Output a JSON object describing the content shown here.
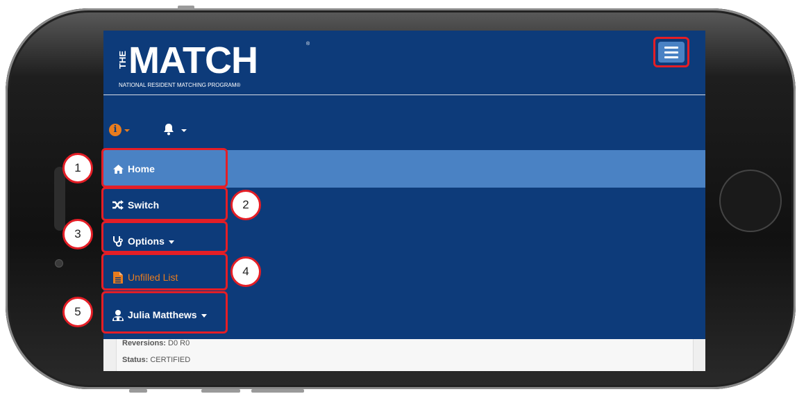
{
  "header": {
    "logo_the": "THE",
    "logo_title": "MATCH",
    "logo_subtitle": "NATIONAL RESIDENT MATCHING PROGRAM®",
    "logo_reg": "®"
  },
  "toolbar": {
    "info_icon": "info-circle-icon",
    "bell_icon": "bell-icon"
  },
  "nav": [
    {
      "label": "Home",
      "icon": "home-icon"
    },
    {
      "label": "Switch",
      "icon": "shuffle-icon"
    },
    {
      "label": "Options",
      "icon": "stethoscope-icon"
    },
    {
      "label": "Unfilled List",
      "icon": "document-icon"
    },
    {
      "label": "Julia Matthews",
      "icon": "user-icon"
    }
  ],
  "status": {
    "reversions_label": "Reversions:",
    "reversions_value": "D0 R0",
    "status_label": "Status:",
    "status_value": "CERTIFIED"
  },
  "callouts": [
    "1",
    "2",
    "3",
    "4",
    "5"
  ],
  "colors": {
    "navy": "#0d3b7a",
    "active_blue": "#4a82c4",
    "highlight_red": "#e41e26",
    "accent_orange": "#e87c1e"
  }
}
